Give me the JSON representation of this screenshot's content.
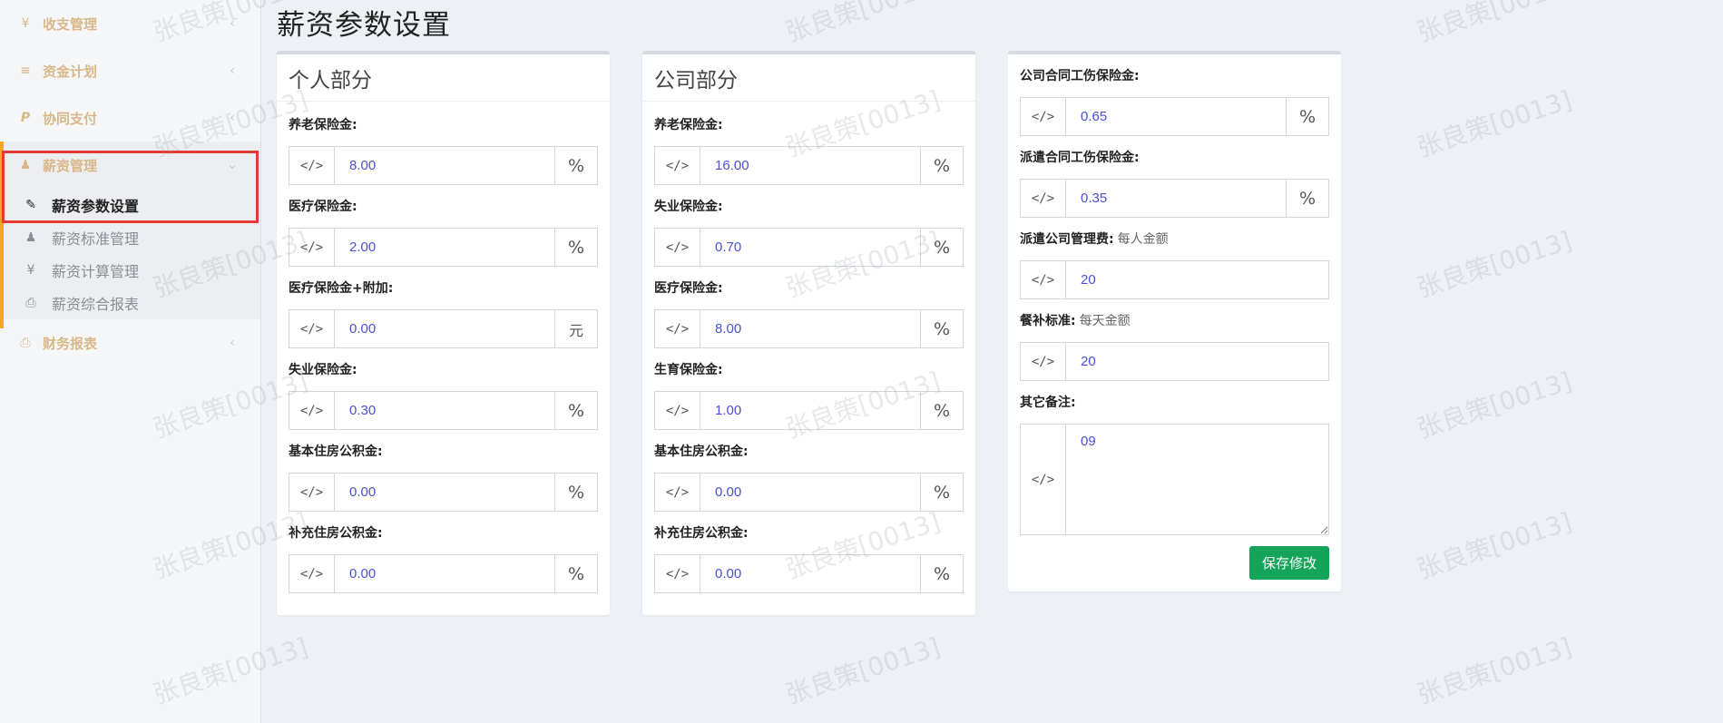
{
  "sidebar": {
    "items": [
      {
        "icon": "yen-icon",
        "glyph": "¥",
        "label": "收支管理"
      },
      {
        "icon": "list-icon",
        "glyph": "≡",
        "label": "资金计划"
      },
      {
        "icon": "paypal-icon",
        "glyph": "P",
        "label": "协同支付"
      },
      {
        "icon": "user-icon",
        "glyph": "♟",
        "label": "薪资管理"
      },
      {
        "icon": "print-icon",
        "glyph": "⎙",
        "label": "财务报表"
      }
    ],
    "submenu": [
      {
        "label": "薪资参数设置"
      },
      {
        "label": "薪资标准管理"
      },
      {
        "label": "薪资计算管理"
      },
      {
        "label": "薪资综合报表"
      }
    ]
  },
  "page": {
    "title": "薪资参数设置"
  },
  "personal": {
    "header": "个人部分",
    "fields": [
      {
        "label": "养老保险金:",
        "value": "8.00",
        "unit": "%"
      },
      {
        "label": "医疗保险金:",
        "value": "2.00",
        "unit": "%"
      },
      {
        "label": "医疗保险金+附加:",
        "value": "0.00",
        "unit": "元"
      },
      {
        "label": "失业保险金:",
        "value": "0.30",
        "unit": "%"
      },
      {
        "label": "基本住房公积金:",
        "value": "0.00",
        "unit": "%"
      },
      {
        "label": "补充住房公积金:",
        "value": "0.00",
        "unit": "%"
      }
    ]
  },
  "company": {
    "header": "公司部分",
    "fields": [
      {
        "label": "养老保险金:",
        "value": "16.00",
        "unit": "%"
      },
      {
        "label": "失业保险金:",
        "value": "0.70",
        "unit": "%"
      },
      {
        "label": "医疗保险金:",
        "value": "8.00",
        "unit": "%"
      },
      {
        "label": "生育保险金:",
        "value": "1.00",
        "unit": "%"
      },
      {
        "label": "基本住房公积金:",
        "value": "0.00",
        "unit": "%"
      },
      {
        "label": "补充住房公积金:",
        "value": "0.00",
        "unit": "%"
      }
    ]
  },
  "other": {
    "fields": [
      {
        "label": "公司合同工伤保险金:",
        "hint": "",
        "value": "0.65",
        "unit": "%"
      },
      {
        "label": "派遣合同工伤保险金:",
        "hint": "",
        "value": "0.35",
        "unit": "%"
      },
      {
        "label": "派遣公司管理费:",
        "hint": "每人金额",
        "value": "20"
      },
      {
        "label": "餐补标准:",
        "hint": "每天金额",
        "value": "20"
      }
    ],
    "remark": {
      "label": "其它备注:",
      "value": "09"
    },
    "save_label": "保存修改"
  },
  "watermark": "张良策[0013]",
  "addon_glyph": "</>",
  "colors": {
    "accent": "#f5a623",
    "save": "#14a45a",
    "input_text": "#4b4fd8",
    "nav_text": "#d9b788"
  }
}
